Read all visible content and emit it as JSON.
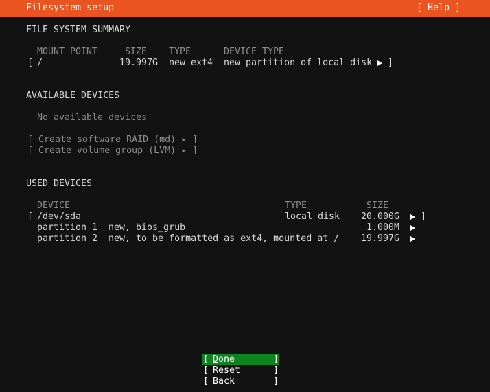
{
  "header": {
    "title": "Filesystem setup",
    "help": "[ Help ]",
    "bg_color": "#e95420"
  },
  "summary": {
    "heading": "FILE SYSTEM SUMMARY",
    "columns": {
      "mount_point": "MOUNT POINT",
      "size": "SIZE",
      "type": "TYPE",
      "device_type": "DEVICE TYPE"
    },
    "rows": [
      {
        "open_bracket": "[",
        "mount_point": "/",
        "size": "19.997G",
        "type": "new ext4",
        "device_type": "new partition of local disk",
        "close_bracket": "]"
      }
    ]
  },
  "available": {
    "heading": "AVAILABLE DEVICES",
    "empty_text": "No available devices",
    "actions": [
      {
        "label": "[ Create software RAID (md) ▸ ]"
      },
      {
        "label": "[ Create volume group (LVM) ▸ ]"
      }
    ]
  },
  "used": {
    "heading": "USED DEVICES",
    "columns": {
      "device": "DEVICE",
      "type": "TYPE",
      "size": "SIZE"
    },
    "rows": [
      {
        "open_bracket": "[",
        "device": "/dev/sda",
        "type": "local disk",
        "size": "20.000G",
        "close_bracket": "]"
      },
      {
        "device": "partition 1",
        "description": "new, bios_grub",
        "size": "1.000M"
      },
      {
        "device": "partition 2",
        "description": "new, to be formatted as ext4, mounted at /",
        "size": "19.997G"
      }
    ]
  },
  "buttons": [
    {
      "open": "[",
      "accel": "D",
      "rest": "one",
      "close": "]",
      "focused": true,
      "focus_color": "#0e8420"
    },
    {
      "open": "[",
      "label": "Reset",
      "close": "]"
    },
    {
      "open": "[",
      "label": "Back",
      "close": "]"
    }
  ]
}
